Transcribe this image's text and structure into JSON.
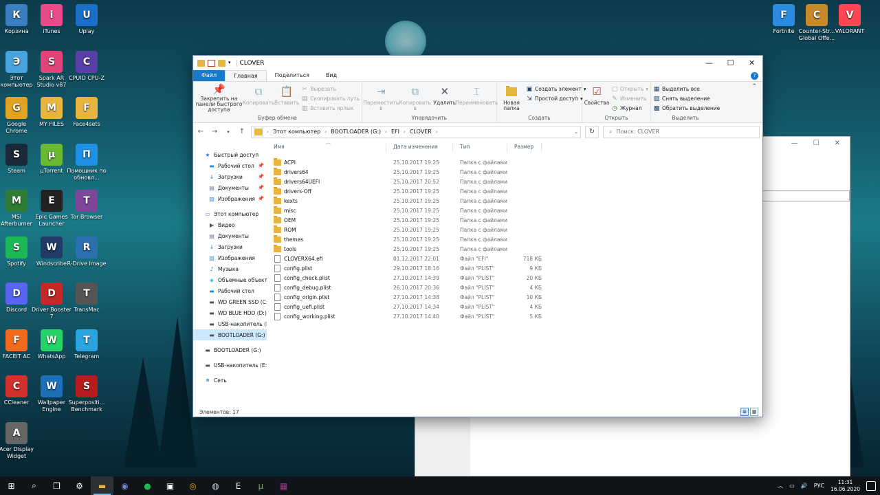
{
  "desktop": {
    "icons_left": [
      {
        "label": "Корзина",
        "icon": "recycle-bin-icon",
        "color": "#3a7fc1"
      },
      {
        "label": "iTunes",
        "icon": "itunes-icon",
        "color": "#e84b8a"
      },
      {
        "label": "Uplay",
        "icon": "uplay-icon",
        "color": "#1a6fc9"
      },
      {
        "label": "Этот компьютер",
        "icon": "computer-icon",
        "color": "#4aa3df"
      },
      {
        "label": "Spark AR Studio v87",
        "icon": "spark-ar-icon",
        "color": "#e0447a"
      },
      {
        "label": "CPUID CPU-Z",
        "icon": "cpuz-icon",
        "color": "#5a3fa8"
      },
      {
        "label": "Google Chrome",
        "icon": "chrome-icon",
        "color": "#e0a420"
      },
      {
        "label": "MY FILES",
        "icon": "folder-icon",
        "color": "#e8b640"
      },
      {
        "label": "Face4sets",
        "icon": "folder-icon",
        "color": "#e8b640"
      },
      {
        "label": "Steam",
        "icon": "steam-icon",
        "color": "#1b2838"
      },
      {
        "label": "µTorrent",
        "icon": "utorrent-icon",
        "color": "#6bb833"
      },
      {
        "label": "Помощник по обновл...",
        "icon": "windows-icon",
        "color": "#1e90e6"
      },
      {
        "label": "MSI Afterburner",
        "icon": "msi-afterburner-icon",
        "color": "#2e7d32"
      },
      {
        "label": "Epic Games Launcher",
        "icon": "epic-games-icon",
        "color": "#222222"
      },
      {
        "label": "Tor Browser",
        "icon": "tor-icon",
        "color": "#7d4698"
      },
      {
        "label": "Spotify",
        "icon": "spotify-icon",
        "color": "#1db954"
      },
      {
        "label": "Windscribe",
        "icon": "windscribe-icon",
        "color": "#1f3b66"
      },
      {
        "label": "R-Drive Image",
        "icon": "r-drive-icon",
        "color": "#2a6fb0"
      },
      {
        "label": "Discord",
        "icon": "discord-icon",
        "color": "#5865f2"
      },
      {
        "label": "Driver Booster 7",
        "icon": "driver-booster-icon",
        "color": "#c62828"
      },
      {
        "label": "TransMac",
        "icon": "transmac-icon",
        "color": "#555555"
      },
      {
        "label": "FACEIT AC",
        "icon": "faceit-icon",
        "color": "#f26b1d"
      },
      {
        "label": "WhatsApp",
        "icon": "whatsapp-icon",
        "color": "#25d366"
      },
      {
        "label": "Telegram",
        "icon": "telegram-icon",
        "color": "#2aa3df"
      },
      {
        "label": "CCleaner",
        "icon": "ccleaner-icon",
        "color": "#d3312c"
      },
      {
        "label": "Wallpaper Engine",
        "icon": "wallpaper-engine-icon",
        "color": "#1d6fb8"
      },
      {
        "label": "Superpositi... Benchmark",
        "icon": "superposition-icon",
        "color": "#b71c1c"
      },
      {
        "label": "Acer Display Widget",
        "icon": "acer-widget-icon",
        "color": "#666666"
      }
    ],
    "icons_right": [
      {
        "label": "Fortnite",
        "icon": "fortnite-icon",
        "color": "#2a8be0"
      },
      {
        "label": "Counter-Str... Global Offe...",
        "icon": "csgo-icon",
        "color": "#c8892a"
      },
      {
        "label": "VALORANT",
        "icon": "valorant-icon",
        "color": "#ff4655"
      }
    ]
  },
  "window": {
    "title": "CLOVER",
    "tabs": [
      "Файл",
      "Главная",
      "Поделиться",
      "Вид"
    ],
    "ribbon": {
      "clipboard": {
        "label": "Буфер обмена",
        "pin": "Закрепить на панели быстрого доступа",
        "copy": "Копировать",
        "paste": "Вставить",
        "cut": "Вырезать",
        "copy_path": "Скопировать путь",
        "paste_shortcut": "Вставить ярлык"
      },
      "organize": {
        "label": "Упорядочить",
        "move_to": "Переместить в",
        "copy_to": "Копировать в",
        "delete": "Удалить",
        "rename": "Переименовать"
      },
      "create": {
        "label": "Создать",
        "new_folder": "Новая папка",
        "new_item": "Создать элемент",
        "easy_access": "Простой доступ"
      },
      "open": {
        "label": "Открыть",
        "properties": "Свойства",
        "open": "Открыть",
        "edit": "Изменить",
        "history": "Журнал"
      },
      "select": {
        "label": "Выделить",
        "select_all": "Выделить все",
        "select_none": "Снять выделение",
        "invert": "Обратить выделение"
      }
    },
    "address": {
      "crumbs": [
        "Этот компьютер",
        "BOOTLOADER (G:)",
        "EFI",
        "CLOVER"
      ],
      "search_placeholder": "Поиск: CLOVER"
    },
    "nav": [
      {
        "label": "Быстрый доступ",
        "icon": "star-icon",
        "level": 1,
        "pinned": false
      },
      {
        "label": "Рабочий стол",
        "icon": "desktop-icon",
        "level": 2,
        "pinned": true
      },
      {
        "label": "Загрузки",
        "icon": "download-icon",
        "level": 2,
        "pinned": true
      },
      {
        "label": "Документы",
        "icon": "documents-icon",
        "level": 2,
        "pinned": true
      },
      {
        "label": "Изображения",
        "icon": "pictures-icon",
        "level": 2,
        "pinned": true
      },
      {
        "label": "",
        "icon": "",
        "level": 0,
        "pinned": false
      },
      {
        "label": "Этот компьютер",
        "icon": "computer-icon",
        "level": 1,
        "pinned": false
      },
      {
        "label": "Видео",
        "icon": "video-icon",
        "level": 2,
        "pinned": false
      },
      {
        "label": "Документы",
        "icon": "documents-icon",
        "level": 2,
        "pinned": false
      },
      {
        "label": "Загрузки",
        "icon": "download-icon",
        "level": 2,
        "pinned": false
      },
      {
        "label": "Изображения",
        "icon": "pictures-icon",
        "level": 2,
        "pinned": false
      },
      {
        "label": "Музыка",
        "icon": "music-icon",
        "level": 2,
        "pinned": false
      },
      {
        "label": "Объемные объекты",
        "icon": "3d-objects-icon",
        "level": 2,
        "pinned": false
      },
      {
        "label": "Рабочий стол",
        "icon": "desktop-icon",
        "level": 2,
        "pinned": false
      },
      {
        "label": "WD GREEN SSD (C:)",
        "icon": "drive-icon",
        "level": 2,
        "pinned": false
      },
      {
        "label": "WD BLUE HDD (D:)",
        "icon": "drive-icon",
        "level": 2,
        "pinned": false
      },
      {
        "label": "USB-накопитель (E",
        "icon": "usb-drive-icon",
        "level": 2,
        "pinned": false
      },
      {
        "label": "BOOTLOADER (G:)",
        "icon": "drive-icon",
        "level": 2,
        "pinned": false,
        "selected": true
      },
      {
        "label": "",
        "icon": "",
        "level": 0,
        "pinned": false
      },
      {
        "label": "BOOTLOADER (G:)",
        "icon": "drive-icon",
        "level": 1,
        "pinned": false
      },
      {
        "label": "",
        "icon": "",
        "level": 0,
        "pinned": false
      },
      {
        "label": "USB-накопитель (E:)",
        "icon": "usb-drive-icon",
        "level": 1,
        "pinned": false
      },
      {
        "label": "",
        "icon": "",
        "level": 0,
        "pinned": false
      },
      {
        "label": "Сеть",
        "icon": "network-icon",
        "level": 1,
        "pinned": false
      }
    ],
    "columns": [
      "Имя",
      "Дата изменения",
      "Тип",
      "Размер"
    ],
    "files": [
      {
        "name": "ACPI",
        "date": "25.10.2017 19:25",
        "type": "Папка с файлами",
        "size": "",
        "kind": "folder"
      },
      {
        "name": "drivers64",
        "date": "25.10.2017 19:25",
        "type": "Папка с файлами",
        "size": "",
        "kind": "folder"
      },
      {
        "name": "drivers64UEFI",
        "date": "25.10.2017 20:52",
        "type": "Папка с файлами",
        "size": "",
        "kind": "folder"
      },
      {
        "name": "drivers-Off",
        "date": "25.10.2017 19:25",
        "type": "Папка с файлами",
        "size": "",
        "kind": "folder"
      },
      {
        "name": "kexts",
        "date": "25.10.2017 19:25",
        "type": "Папка с файлами",
        "size": "",
        "kind": "folder"
      },
      {
        "name": "misc",
        "date": "25.10.2017 19:25",
        "type": "Папка с файлами",
        "size": "",
        "kind": "folder"
      },
      {
        "name": "OEM",
        "date": "25.10.2017 19:25",
        "type": "Папка с файлами",
        "size": "",
        "kind": "folder"
      },
      {
        "name": "ROM",
        "date": "25.10.2017 19:25",
        "type": "Папка с файлами",
        "size": "",
        "kind": "folder"
      },
      {
        "name": "themes",
        "date": "25.10.2017 19:25",
        "type": "Папка с файлами",
        "size": "",
        "kind": "folder"
      },
      {
        "name": "tools",
        "date": "25.10.2017 19:25",
        "type": "Папка с файлами",
        "size": "",
        "kind": "folder"
      },
      {
        "name": "CLOVERX64.efi",
        "date": "01.12.2017 22:01",
        "type": "Файл \"EFI\"",
        "size": "718 КБ",
        "kind": "file"
      },
      {
        "name": "config.plist",
        "date": "29.10.2017 18:16",
        "type": "Файл \"PLIST\"",
        "size": "9 КБ",
        "kind": "file"
      },
      {
        "name": "config_check.plist",
        "date": "27.10.2017 14:39",
        "type": "Файл \"PLIST\"",
        "size": "20 КБ",
        "kind": "file"
      },
      {
        "name": "config_debug.plist",
        "date": "26.10.2017 20:36",
        "type": "Файл \"PLIST\"",
        "size": "4 КБ",
        "kind": "file"
      },
      {
        "name": "config_origin.plist",
        "date": "27.10.2017 14:38",
        "type": "Файл \"PLIST\"",
        "size": "10 КБ",
        "kind": "file"
      },
      {
        "name": "config_uefi.plist",
        "date": "27.10.2017 14:34",
        "type": "Файл \"PLIST\"",
        "size": "4 КБ",
        "kind": "file"
      },
      {
        "name": "config_working.plist",
        "date": "27.10.2017 14:40",
        "type": "Файл \"PLIST\"",
        "size": "5 КБ",
        "kind": "file"
      }
    ],
    "status": "Элементов: 17"
  },
  "taskbar": {
    "lang": "РУС",
    "time": "11:31",
    "date": "16.06.2020",
    "apps": [
      {
        "icon": "start-icon",
        "active": false
      },
      {
        "icon": "search-icon",
        "active": false
      },
      {
        "icon": "task-view-icon",
        "active": false
      },
      {
        "icon": "settings-icon",
        "active": false
      },
      {
        "icon": "file-explorer-icon",
        "active": true
      },
      {
        "icon": "discord-icon",
        "active": false
      },
      {
        "icon": "spotify-icon",
        "active": false
      },
      {
        "icon": "store-icon",
        "active": false
      },
      {
        "icon": "chrome-icon",
        "active": false
      },
      {
        "icon": "steam-icon",
        "active": false
      },
      {
        "icon": "epic-games-icon",
        "active": false
      },
      {
        "icon": "utorrent-icon",
        "active": false
      },
      {
        "icon": "winrar-icon",
        "active": false
      }
    ]
  }
}
